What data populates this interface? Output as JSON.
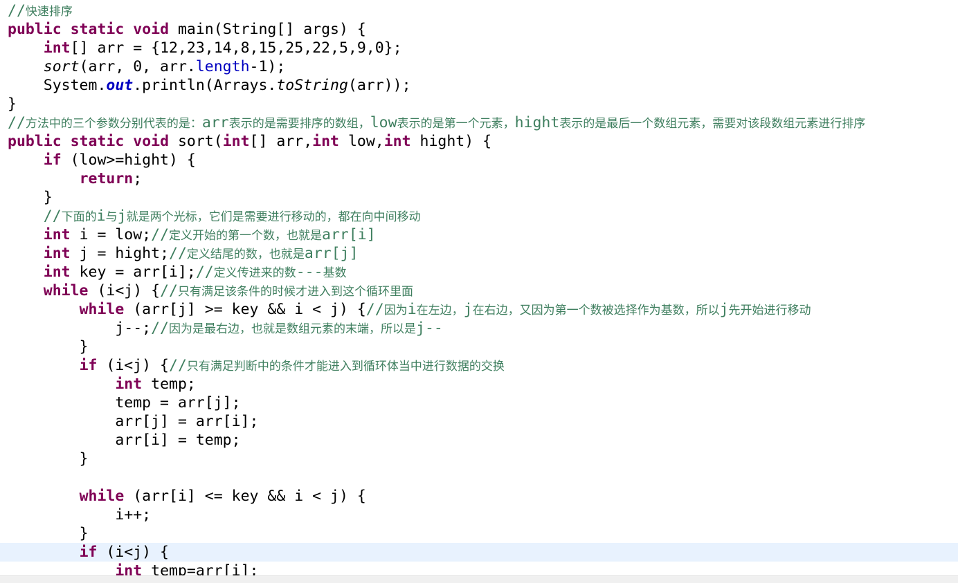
{
  "editor": {
    "lines": [
      [
        [
          "cm",
          "//快速排序"
        ]
      ],
      [
        [
          "kw",
          "public"
        ],
        [
          "t",
          " "
        ],
        [
          "kw",
          "static"
        ],
        [
          "t",
          " "
        ],
        [
          "kw",
          "void"
        ],
        [
          "t",
          " main(String[] args) {"
        ]
      ],
      [
        [
          "t",
          "    "
        ],
        [
          "kw",
          "int"
        ],
        [
          "t",
          "[] arr = {12,23,14,8,15,25,22,5,9,0};"
        ]
      ],
      [
        [
          "t",
          "    "
        ],
        [
          "it",
          "sort"
        ],
        [
          "t",
          "(arr, 0, arr."
        ],
        [
          "fld",
          "length"
        ],
        [
          "t",
          "-1);"
        ]
      ],
      [
        [
          "t",
          "    System."
        ],
        [
          "sfld",
          "out"
        ],
        [
          "t",
          ".println(Arrays."
        ],
        [
          "it",
          "toString"
        ],
        [
          "t",
          "(arr));"
        ]
      ],
      [
        [
          "t",
          "}"
        ]
      ],
      [
        [
          "cm",
          "//方法中的三个参数分别代表的是：arr表示的是需要排序的数组，low表示的是第一个元素，hight表示的是最后一个数组元素，需要对该段数组元素进行排序"
        ]
      ],
      [
        [
          "kw",
          "public"
        ],
        [
          "t",
          " "
        ],
        [
          "kw",
          "static"
        ],
        [
          "t",
          " "
        ],
        [
          "kw",
          "void"
        ],
        [
          "t",
          " sort("
        ],
        [
          "kw",
          "int"
        ],
        [
          "t",
          "[] arr,"
        ],
        [
          "kw",
          "int"
        ],
        [
          "t",
          " low,"
        ],
        [
          "kw",
          "int"
        ],
        [
          "t",
          " hight) {"
        ]
      ],
      [
        [
          "t",
          "    "
        ],
        [
          "kw",
          "if"
        ],
        [
          "t",
          " (low>=hight) {"
        ]
      ],
      [
        [
          "t",
          "        "
        ],
        [
          "kw",
          "return"
        ],
        [
          "t",
          ";"
        ]
      ],
      [
        [
          "t",
          "    }"
        ]
      ],
      [
        [
          "t",
          "    "
        ],
        [
          "cm",
          "//下面的i与j就是两个光标，它们是需要进行移动的，都在向中间移动"
        ]
      ],
      [
        [
          "t",
          "    "
        ],
        [
          "kw",
          "int"
        ],
        [
          "t",
          " i = low;"
        ],
        [
          "cm",
          "//定义开始的第一个数，也就是arr[i]"
        ]
      ],
      [
        [
          "t",
          "    "
        ],
        [
          "kw",
          "int"
        ],
        [
          "t",
          " j = hight;"
        ],
        [
          "cm",
          "//定义结尾的数，也就是arr[j]"
        ]
      ],
      [
        [
          "t",
          "    "
        ],
        [
          "kw",
          "int"
        ],
        [
          "t",
          " key = arr[i];"
        ],
        [
          "cm",
          "//定义传进来的数---基数"
        ]
      ],
      [
        [
          "t",
          "    "
        ],
        [
          "kw",
          "while"
        ],
        [
          "t",
          " (i<j) {"
        ],
        [
          "cm",
          "//只有满足该条件的时候才进入到这个循环里面"
        ]
      ],
      [
        [
          "t",
          "        "
        ],
        [
          "kw",
          "while"
        ],
        [
          "t",
          " (arr[j] >= key && i < j) {"
        ],
        [
          "cm",
          "//因为i在左边，j在右边，又因为第一个数被选择作为基数，所以j先开始进行移动"
        ]
      ],
      [
        [
          "t",
          "            j--;"
        ],
        [
          "cm",
          "//因为是最右边，也就是数组元素的末端，所以是j--"
        ]
      ],
      [
        [
          "t",
          "        }"
        ]
      ],
      [
        [
          "t",
          "        "
        ],
        [
          "kw",
          "if"
        ],
        [
          "t",
          " (i<j) {"
        ],
        [
          "cm",
          "//只有满足判断中的条件才能进入到循环体当中进行数据的交换"
        ]
      ],
      [
        [
          "t",
          "            "
        ],
        [
          "kw",
          "int"
        ],
        [
          "t",
          " temp;"
        ]
      ],
      [
        [
          "t",
          "            temp = arr[j];"
        ]
      ],
      [
        [
          "t",
          "            arr[j] = arr[i];"
        ]
      ],
      [
        [
          "t",
          "            arr[i] = temp;"
        ]
      ],
      [
        [
          "t",
          "        }"
        ]
      ],
      [
        [
          "t",
          ""
        ]
      ],
      [
        [
          "t",
          "        "
        ],
        [
          "kw",
          "while"
        ],
        [
          "t",
          " (arr[i] <= key && i < j) {"
        ]
      ],
      [
        [
          "t",
          "            i++;"
        ]
      ],
      [
        [
          "t",
          "        }"
        ]
      ],
      [
        [
          "t",
          "        "
        ],
        [
          "kw",
          "if"
        ],
        [
          "t",
          " (i<j) {"
        ]
      ],
      [
        [
          "t",
          "            "
        ],
        [
          "kw",
          "int"
        ],
        [
          "t",
          " temp=arr[i];"
        ]
      ]
    ],
    "current_line_index": 29,
    "colors": {
      "keyword": "#7f0055",
      "comment": "#3f7f5f",
      "field": "#0000c0",
      "current_line": "#e8f2fe"
    }
  }
}
